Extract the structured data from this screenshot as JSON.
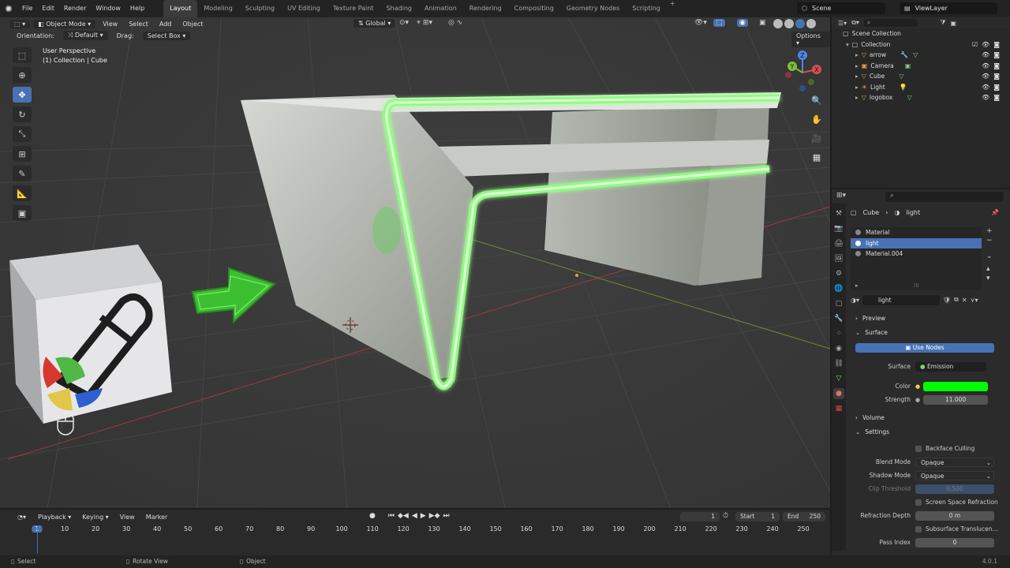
{
  "menubar": {
    "logo": "Blender",
    "menus": [
      "File",
      "Edit",
      "Render",
      "Window",
      "Help"
    ],
    "workspaces": [
      "Layout",
      "Modeling",
      "Sculpting",
      "UV Editing",
      "Texture Paint",
      "Shading",
      "Animation",
      "Rendering",
      "Compositing",
      "Geometry Nodes",
      "Scripting"
    ],
    "active_workspace": "Layout",
    "add_tab": "+",
    "scene": "Scene",
    "view_layer": "ViewLayer"
  },
  "viewport": {
    "mode": "Object Mode",
    "menus": [
      "View",
      "Select",
      "Add",
      "Object"
    ],
    "orientation_label": "Orientation:",
    "orientation_value": "Default",
    "drag_label": "Drag:",
    "drag_value": "Select Box",
    "transform_orientation": "Global",
    "options": "Options",
    "info_line1": "User Perspective",
    "info_line2": "(1) Collection | Cube",
    "gizmo_axes": {
      "x": "X",
      "y": "Y",
      "z": "Z"
    }
  },
  "outliner": {
    "root": "Scene Collection",
    "collection": "Collection",
    "items": [
      {
        "name": "arrow"
      },
      {
        "name": "Camera"
      },
      {
        "name": "Cube"
      },
      {
        "name": "Light"
      },
      {
        "name": "logobox"
      }
    ]
  },
  "properties": {
    "breadcrumb_object": "Cube",
    "breadcrumb_material": "light",
    "slots": [
      "Material",
      "light",
      "Material.004"
    ],
    "active_slot": "light",
    "material_name": "light",
    "preview_label": "Preview",
    "surface_label": "Surface",
    "use_nodes": "Use Nodes",
    "surface_field_label": "Surface",
    "surface_value": "Emission",
    "color_label": "Color",
    "emission_color": "#00ff00",
    "strength_label": "Strength",
    "strength_value": "11.000",
    "volume_label": "Volume",
    "settings_label": "Settings",
    "backface_culling": "Backface Culling",
    "blend_mode_label": "Blend Mode",
    "blend_mode_value": "Opaque",
    "shadow_mode_label": "Shadow Mode",
    "shadow_mode_value": "Opaque",
    "clip_threshold_label": "Clip Threshold",
    "clip_threshold_value": "0.500",
    "screen_space_refraction": "Screen Space Refraction",
    "refraction_depth_label": "Refraction Depth",
    "refraction_depth_value": "0 m",
    "subsurface_translucency": "Subsurface Translucen...",
    "pass_index_label": "Pass Index",
    "pass_index_value": "0"
  },
  "timeline": {
    "menus": [
      "Playback",
      "Keying",
      "View",
      "Marker"
    ],
    "current_frame": "1",
    "start_label": "Start",
    "start_value": "1",
    "end_label": "End",
    "end_value": "250",
    "ticks": [
      "1",
      "10",
      "20",
      "30",
      "40",
      "50",
      "60",
      "70",
      "80",
      "90",
      "100",
      "110",
      "120",
      "130",
      "140",
      "150",
      "160",
      "170",
      "180",
      "190",
      "200",
      "210",
      "220",
      "230",
      "240",
      "250"
    ]
  },
  "statusbar": {
    "select": "Select",
    "rotate_view": "Rotate View",
    "object": "Object",
    "version": "4.0.1"
  },
  "colors": {
    "accent": "#4772b3",
    "emission_glow": "#b8ffb0",
    "arrow_green": "#3bbf2f"
  }
}
